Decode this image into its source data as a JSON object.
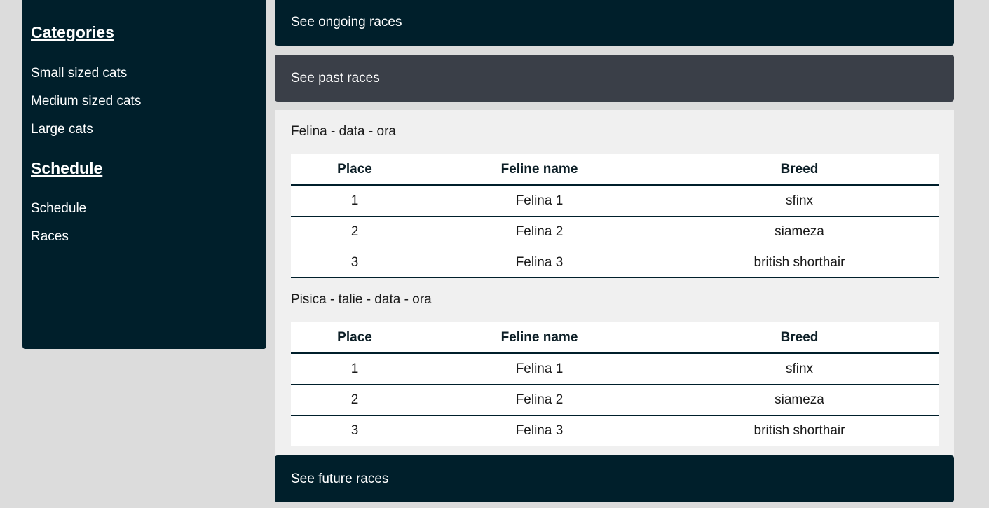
{
  "sidebar": {
    "categories_title": "Categories",
    "categories": [
      "Small sized cats",
      "Medium sized cats",
      "Large cats"
    ],
    "schedule_title": "Schedule",
    "schedule_links": [
      "Schedule",
      "Races"
    ]
  },
  "accordion": {
    "ongoing": "See ongoing races",
    "past": "See past races",
    "future": "See future races"
  },
  "races": [
    {
      "title": "Felina - data - ora",
      "headers": [
        "Place",
        "Feline name",
        "Breed"
      ],
      "rows": [
        [
          "1",
          "Felina 1",
          "sfinx"
        ],
        [
          "2",
          "Felina 2",
          "siameza"
        ],
        [
          "3",
          "Felina 3",
          "british shorthair"
        ]
      ]
    },
    {
      "title": "Pisica - talie - data - ora",
      "headers": [
        "Place",
        "Feline name",
        "Breed"
      ],
      "rows": [
        [
          "1",
          "Felina 1",
          "sfinx"
        ],
        [
          "2",
          "Felina 2",
          "siameza"
        ],
        [
          "3",
          "Felina 3",
          "british shorthair"
        ]
      ]
    }
  ]
}
